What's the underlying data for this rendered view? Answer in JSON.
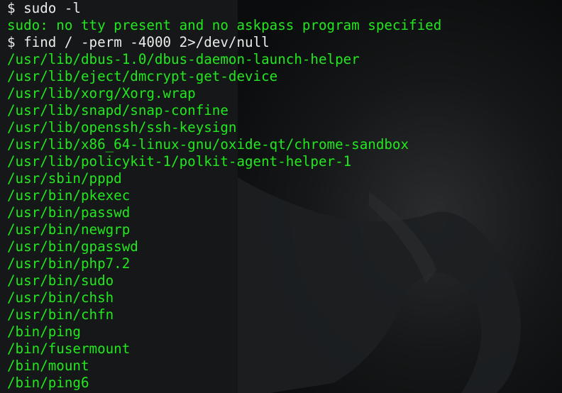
{
  "terminal": {
    "lines": [
      {
        "type": "command",
        "prompt": "$",
        "text": "sudo -l"
      },
      {
        "type": "output",
        "text": "sudo: no tty present and no askpass program specified"
      },
      {
        "type": "command",
        "prompt": "$",
        "text": "find / -perm -4000 2>/dev/null"
      },
      {
        "type": "output",
        "text": "/usr/lib/dbus-1.0/dbus-daemon-launch-helper"
      },
      {
        "type": "output",
        "text": "/usr/lib/eject/dmcrypt-get-device"
      },
      {
        "type": "output",
        "text": "/usr/lib/xorg/Xorg.wrap"
      },
      {
        "type": "output",
        "text": "/usr/lib/snapd/snap-confine"
      },
      {
        "type": "output",
        "text": "/usr/lib/openssh/ssh-keysign"
      },
      {
        "type": "output",
        "text": "/usr/lib/x86_64-linux-gnu/oxide-qt/chrome-sandbox"
      },
      {
        "type": "output",
        "text": "/usr/lib/policykit-1/polkit-agent-helper-1"
      },
      {
        "type": "output",
        "text": "/usr/sbin/pppd"
      },
      {
        "type": "output",
        "text": "/usr/bin/pkexec"
      },
      {
        "type": "output",
        "text": "/usr/bin/passwd"
      },
      {
        "type": "output",
        "text": "/usr/bin/newgrp"
      },
      {
        "type": "output",
        "text": "/usr/bin/gpasswd"
      },
      {
        "type": "output",
        "text": "/usr/bin/php7.2"
      },
      {
        "type": "output",
        "text": "/usr/bin/sudo"
      },
      {
        "type": "output",
        "text": "/usr/bin/chsh"
      },
      {
        "type": "output",
        "text": "/usr/bin/chfn"
      },
      {
        "type": "output",
        "text": "/bin/ping"
      },
      {
        "type": "output",
        "text": "/bin/fusermount"
      },
      {
        "type": "output",
        "text": "/bin/mount"
      },
      {
        "type": "output",
        "text": "/bin/ping6"
      }
    ]
  },
  "colors": {
    "output_green": "#22e81e",
    "command_white": "#ececec",
    "background": "#0d0f10"
  }
}
